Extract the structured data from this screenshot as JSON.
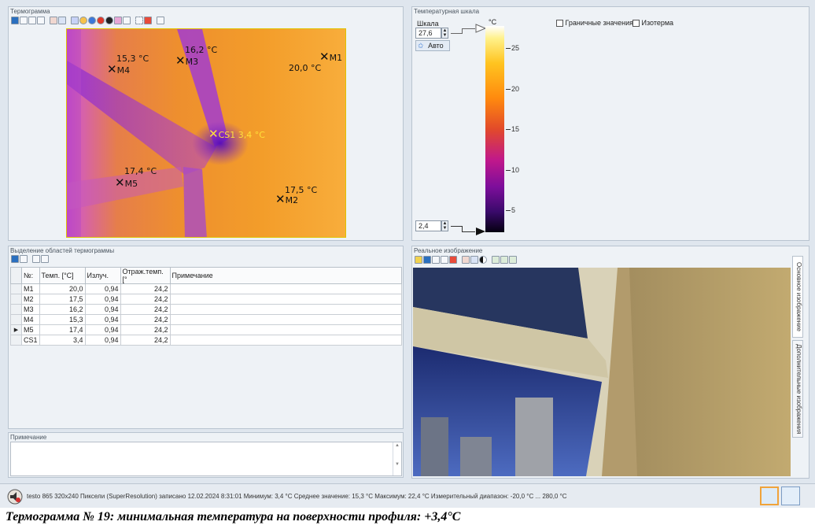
{
  "thermogram": {
    "title": "Термограмма",
    "markers": [
      {
        "id": "M1",
        "label": "M1",
        "temp": "20,0 °C"
      },
      {
        "id": "M2",
        "label": "M2",
        "temp": "17,5 °C"
      },
      {
        "id": "M3",
        "label": "M3",
        "temp": "16,2 °C"
      },
      {
        "id": "M4",
        "label": "M4",
        "temp": "15,3 °C"
      },
      {
        "id": "M5",
        "label": "M5",
        "temp": "17,4 °C"
      },
      {
        "id": "CS1",
        "label": "CS1 3,4 °C"
      }
    ]
  },
  "scale": {
    "title": "Температурная шкала",
    "scale_label": "Шкала",
    "max_value": "27,6",
    "min_value": "2,4",
    "auto_label": "Авто",
    "unit": "°C",
    "ticks": [
      "25",
      "20",
      "15",
      "10",
      "5"
    ],
    "limit_values_label": "Граничные значения",
    "isotherm_label": "Изотерма"
  },
  "regions": {
    "title": "Выделение областей термограммы",
    "columns": [
      "№:",
      "Темп. [°C]",
      "Излуч.",
      "Отраж.темп. [°",
      "Примечание"
    ],
    "rows": [
      {
        "id": "M1",
        "temp": "20,0",
        "emis": "0,94",
        "refl": "24,2",
        "note": ""
      },
      {
        "id": "M2",
        "temp": "17,5",
        "emis": "0,94",
        "refl": "24,2",
        "note": ""
      },
      {
        "id": "M3",
        "temp": "16,2",
        "emis": "0,94",
        "refl": "24,2",
        "note": ""
      },
      {
        "id": "M4",
        "temp": "15,3",
        "emis": "0,94",
        "refl": "24,2",
        "note": ""
      },
      {
        "id": "M5",
        "temp": "17,4",
        "emis": "0,94",
        "refl": "24,2",
        "note": ""
      },
      {
        "id": "CS1",
        "temp": "3,4",
        "emis": "0,94",
        "refl": "24,2",
        "note": ""
      }
    ]
  },
  "note": {
    "title": "Примечание"
  },
  "real_image": {
    "title": "Реальное изображение",
    "tab_main": "Основное изображение",
    "tab_extra": "Дополнительные изображения"
  },
  "status_bar": {
    "text": "testo 865 320x240 Пиксели (SuperResolution) записано 12.02.2024 8:31:01 Минимум: 3,4 °C  Среднее значение: 15,3 °C  Максимум: 22,4 °C  Измерительный диапазон: -20,0 °C ... 280,0 °C"
  },
  "caption": "Термограмма № 19: минимальная температура на поверхности профиля: +3,4°C"
}
